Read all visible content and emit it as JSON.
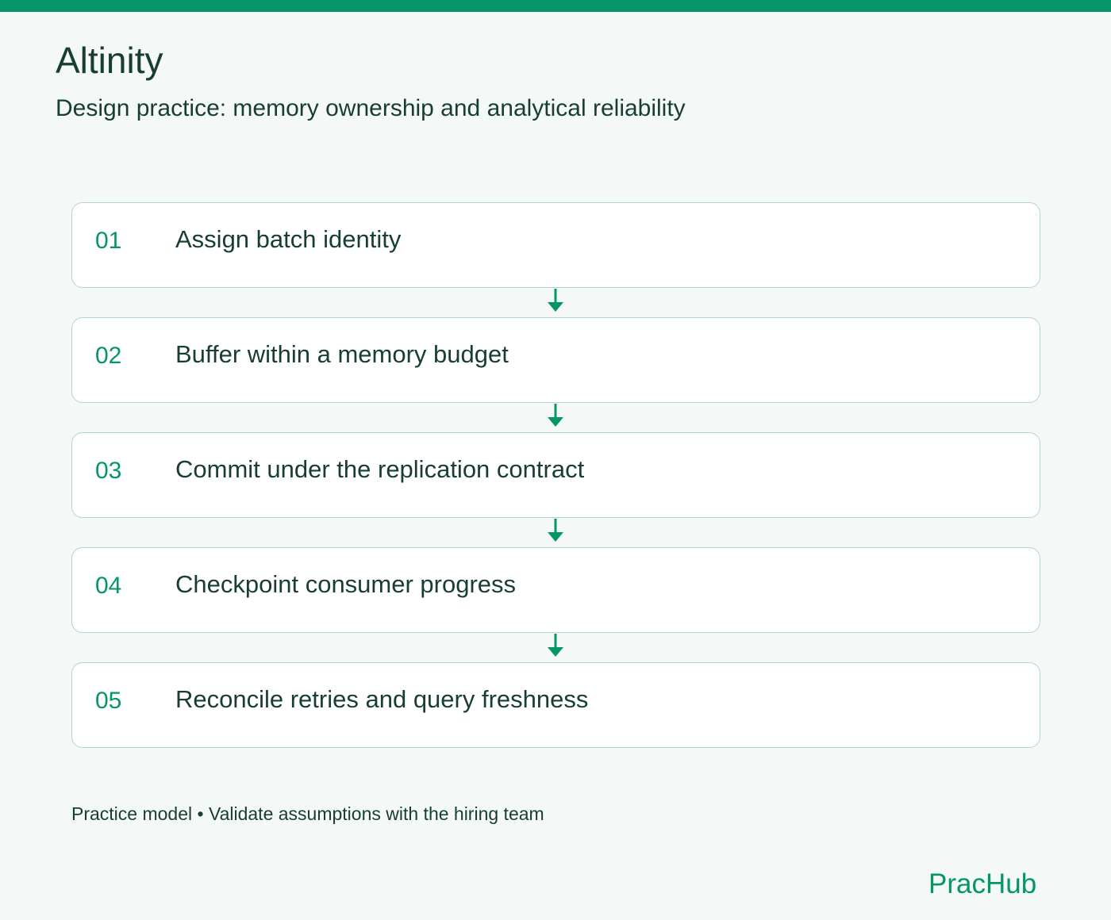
{
  "header": {
    "title": "Altinity",
    "subtitle": "Design practice: memory ownership and analytical reliability"
  },
  "steps": [
    {
      "number": "01",
      "label": "Assign batch identity"
    },
    {
      "number": "02",
      "label": "Buffer within a memory budget"
    },
    {
      "number": "03",
      "label": "Commit under the replication contract"
    },
    {
      "number": "04",
      "label": "Checkpoint consumer progress"
    },
    {
      "number": "05",
      "label": "Reconcile retries and query freshness"
    }
  ],
  "footer": {
    "note": "Practice model • Validate assumptions with the hiring team",
    "brand": "PracHub"
  },
  "colors": {
    "accent": "#069569",
    "text": "#173d35",
    "background": "#f4f8f6",
    "card_border": "#b3d6cb"
  },
  "icons": {
    "connector": "arrow-down-icon"
  }
}
